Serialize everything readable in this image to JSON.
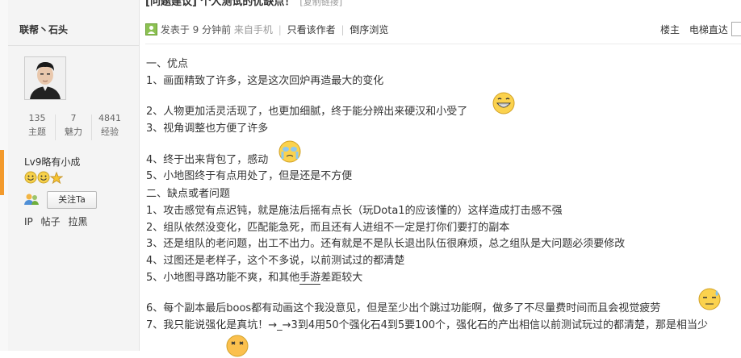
{
  "sidebar": {
    "username": "联帮丶石头",
    "stats": [
      {
        "value": "135",
        "label": "主题"
      },
      {
        "value": "7",
        "label": "魅力"
      },
      {
        "value": "4841",
        "label": "经验"
      }
    ],
    "level": "Lv9略有小成",
    "follow_label": "关注Ta",
    "links": [
      "IP",
      "帖子",
      "拉黑"
    ]
  },
  "post": {
    "title_fragment": "[问题建议] 个人测试的优缺点！",
    "title_suffix": "[复制链接]",
    "meta": {
      "posted_at": "发表于 9 分钟前",
      "source": "来自手机",
      "only_author": "只看该作者",
      "reverse": "倒序浏览",
      "floor_label": "楼主",
      "jump_label": "电梯直达"
    },
    "lines": [
      "一、优点",
      "1、画面精致了许多，这是这次回炉再造最大的变化",
      "2、人物更加活灵活现了，也更加细腻，终于能分辨出来硬汉和小受了",
      "3、视角调整也方便了许多",
      "4、终于出来背包了，感动",
      "5、小地图终于有点用处了，但是还是不方便",
      "二、缺点或者问题",
      "1、攻击感觉有点迟钝，就是施法后摇有点长（玩Dota1的应该懂的）这样造成打击感不强",
      "2、组队依然没变化，匹配能急死，而且还有人进组不一定是打你们要打的副本",
      "3、还是组队的老问题，出工不出力。还有就是不是队长退出队伍很麻烦，总之组队是大问题必须要修改",
      "4、过图还是老样子，这个不多说，以前测试过的都清楚",
      "5、小地图寻路功能不爽，和其他",
      "6、每个副本最后boos都有动画这个我没意见，但是至少出个跳过功能啊，做多了不尽量费时间而且会视觉疲劳",
      "7、我只能说强化是真坑！→_→3到4用50个强化石4到5要100个，强化石的产出相信以前测试玩过的都清楚，那是相当少"
    ],
    "link_word": "手游",
    "line5b_tail": "差距较大"
  },
  "colors": {
    "accent_orange": "#f39a2c",
    "sidebar_bg": "#f4f4f4"
  }
}
